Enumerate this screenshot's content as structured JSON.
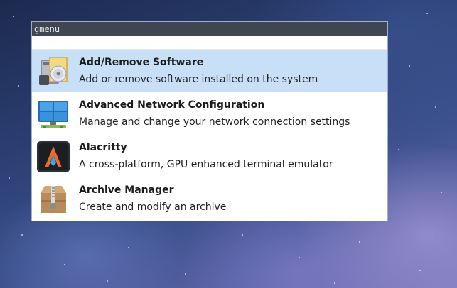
{
  "window": {
    "title": "gmenu",
    "search_value": ""
  },
  "items": [
    {
      "name": "Add/Remove Software",
      "description": "Add or remove software installed on the system",
      "icon": "software-package-icon",
      "selected": true
    },
    {
      "name": "Advanced Network Configuration",
      "description": "Manage and change your network connection settings",
      "icon": "network-icon",
      "selected": false
    },
    {
      "name": "Alacritty",
      "description": "A cross-platform, GPU enhanced terminal emulator",
      "icon": "alacritty-icon",
      "selected": false
    },
    {
      "name": "Archive Manager",
      "description": "Create and modify an archive",
      "icon": "archive-box-icon",
      "selected": false
    }
  ],
  "colors": {
    "selected_row": "#c7dff7",
    "titlebar": "#3f4652",
    "window_border": "#9fb0c8"
  }
}
